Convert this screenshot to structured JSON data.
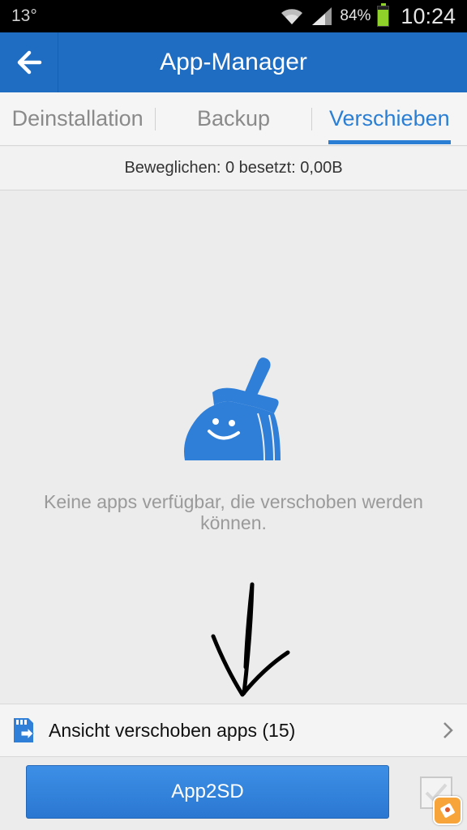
{
  "status_bar": {
    "temperature": "13°",
    "battery": "84%",
    "battery_level": 0.84,
    "time": "10:24"
  },
  "header": {
    "title": "App-Manager"
  },
  "tabs": [
    {
      "label": "Deinstallation",
      "active": false
    },
    {
      "label": "Backup",
      "active": false
    },
    {
      "label": "Verschieben",
      "active": true
    }
  ],
  "info_bar": {
    "text": "Beweglichen: 0 besetzt: 0,00B"
  },
  "empty_state": {
    "icon": "broom-smiley-icon",
    "message": "Keine apps verfügbar, die verschoben werden können."
  },
  "moved_apps": {
    "icon": "sd-card-move-icon",
    "label": "Ansicht verschoben apps (15)"
  },
  "bottom": {
    "primary_button": "App2SD",
    "select_all_checked": false
  },
  "colors": {
    "header_bg": "#1f6dc2",
    "accent": "#2a7fd4",
    "button_bg": "#2f7fd8"
  }
}
